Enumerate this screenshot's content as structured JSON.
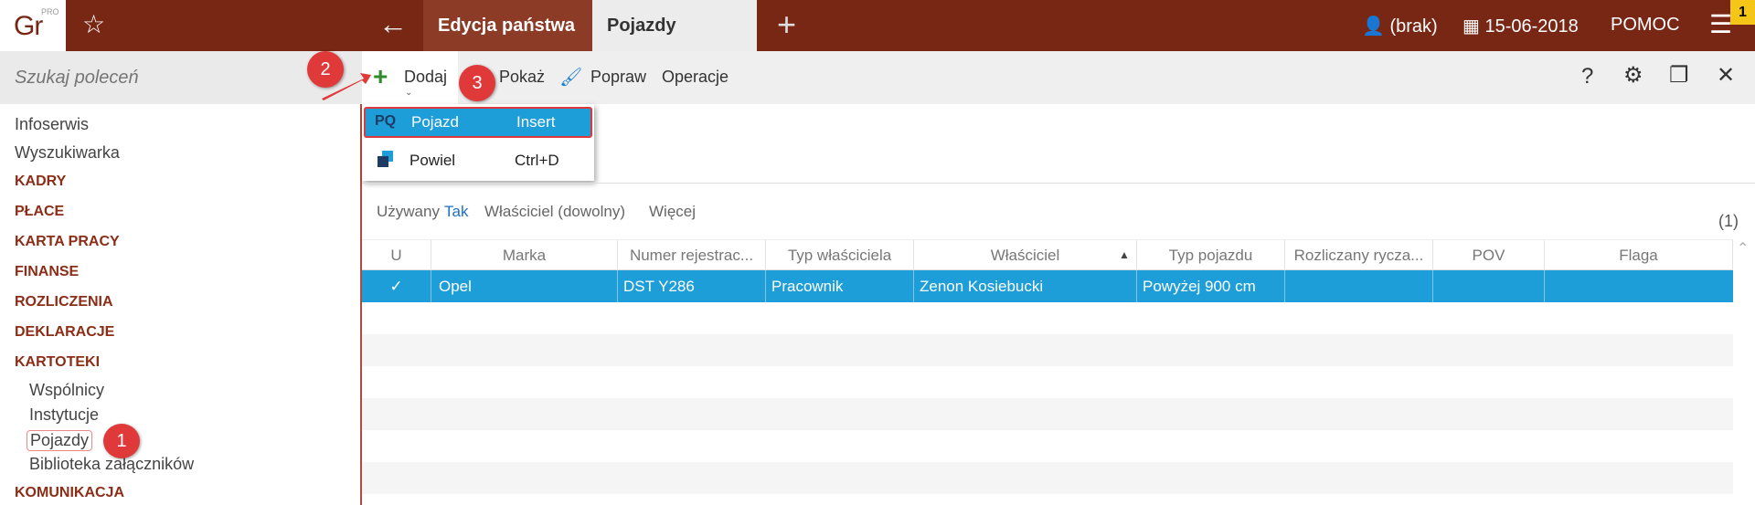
{
  "app": {
    "logo_text": "Gr",
    "logo_sup": "PRO"
  },
  "tabs": [
    {
      "label": "Edycja państwa"
    },
    {
      "label": "Pojazdy"
    }
  ],
  "header": {
    "user": "(brak)",
    "date": "15-06-2018",
    "help": "POMOC",
    "notifications": "1"
  },
  "search": {
    "placeholder": "Szukaj poleceń"
  },
  "sidebar": {
    "items": [
      {
        "label": "Infoserwis"
      },
      {
        "label": "Wyszukiwarka"
      },
      {
        "label": "KADRY"
      },
      {
        "label": "PŁACE"
      },
      {
        "label": "KARTA PRACY"
      },
      {
        "label": "FINANSE"
      },
      {
        "label": "ROZLICZENIA"
      },
      {
        "label": "DEKLARACJE"
      },
      {
        "label": "KARTOTEKI"
      },
      {
        "label": "Wspólnicy"
      },
      {
        "label": "Instytucje"
      },
      {
        "label": "Pojazdy"
      },
      {
        "label": "Biblioteka załączników"
      },
      {
        "label": "KOMUNIKACJA"
      }
    ]
  },
  "toolbar": {
    "add": "Dodaj",
    "show": "Pokaż",
    "edit": "Popraw",
    "operations": "Operacje"
  },
  "dropdown": [
    {
      "icon": "PQ",
      "label": "Pojazd",
      "shortcut": "Insert"
    },
    {
      "label": "Powiel",
      "shortcut": "Ctrl+D"
    }
  ],
  "filters": {
    "used_label": "Używany",
    "used_value": "Tak",
    "owner": "Właściciel (dowolny)",
    "more": "Więcej"
  },
  "count": "(1)",
  "table": {
    "columns": [
      "U",
      "Marka",
      "Numer rejestrac...",
      "Typ właściciela",
      "Właściciel",
      "Typ pojazdu",
      "Rozliczany rycza...",
      "POV",
      "Flaga"
    ],
    "rows": [
      {
        "u": "✓",
        "marka": "Opel",
        "numer": "DST Y286",
        "typ_wlasciciela": "Pracownik",
        "wlasciciel": "Zenon Kosiebucki",
        "typ_pojazdu": "Powyżej 900 cm",
        "rozliczany": "",
        "pov": "",
        "flaga": ""
      }
    ]
  },
  "callouts": [
    "1",
    "2",
    "3"
  ],
  "colors": {
    "brand": "#782714",
    "accent": "#1e9ed9",
    "callout": "#e0393a"
  }
}
